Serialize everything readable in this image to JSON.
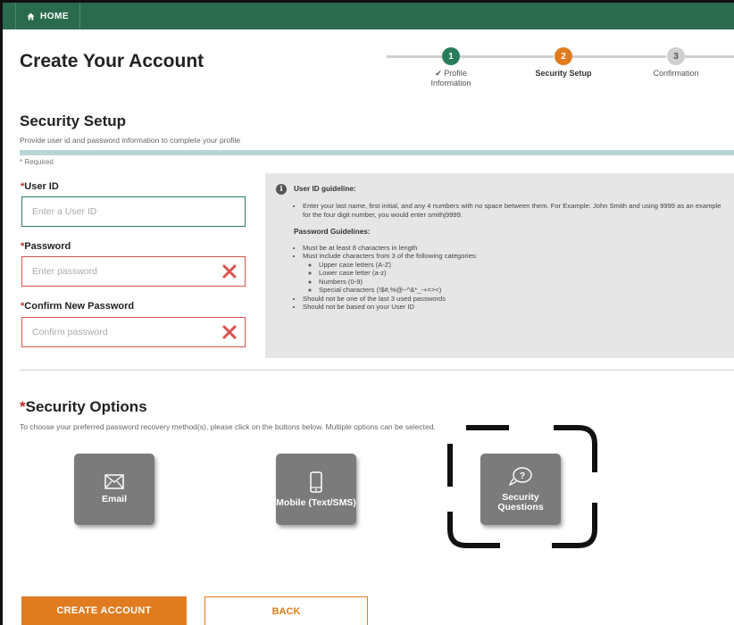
{
  "nav": {
    "home_label": "HOME"
  },
  "page": {
    "title": "Create Your Account"
  },
  "stepper": {
    "steps": [
      {
        "number": "1",
        "label": "✔ Profile Information",
        "color": "#2a7d5c",
        "state": "done"
      },
      {
        "number": "2",
        "label": "Security Setup",
        "color": "#e07c1f",
        "state": "current"
      },
      {
        "number": "3",
        "label": "Confirmation",
        "color": "#cfcfcf",
        "state": "upcoming"
      }
    ]
  },
  "security_setup": {
    "title": "Security Setup",
    "description": "Provide user id and password information to complete your profile",
    "required_note": "* Required",
    "fields": {
      "user_id": {
        "label": "User ID",
        "placeholder": "Enter a User ID",
        "value": ""
      },
      "password": {
        "label": "Password",
        "placeholder": "Enter password",
        "value": ""
      },
      "confirm": {
        "label": "Confirm New Password",
        "placeholder": "Confirm password",
        "value": ""
      }
    }
  },
  "guidelines": {
    "user_id_heading": "User ID guideline:",
    "user_id_items": [
      "Enter your last name, first initial, and any 4 numbers with no space between them. For Example: John Smith and using 9999 as an example for the four digit number, you would enter smithj9999."
    ],
    "password_heading": "Password Guidelines:",
    "password_items_a": [
      "Must be at least 8 characters in length",
      "Must include characters from 3 of the following categories:"
    ],
    "password_categories": [
      "Upper case letters (A-Z)",
      "Lower case letter (a-z)",
      "Numbers (0-9)",
      "Special characters (!$#,%@~^&*_-+=><)"
    ],
    "password_items_b": [
      "Should not be one of the last 3 used passwords",
      "Should not be based on your User ID"
    ]
  },
  "security_options": {
    "title": "Security Options",
    "description": "To choose your preferred password recovery method(s), please click on the buttons below. Multiple options can be selected.",
    "options": [
      {
        "label": "Email",
        "icon": "envelope-icon"
      },
      {
        "label": "Mobile (Text/SMS)",
        "icon": "mobile-phone-icon"
      },
      {
        "label": "Security Questions",
        "icon": "question-chat-icon"
      }
    ]
  },
  "actions": {
    "create_label": "CREATE ACCOUNT",
    "back_label": "BACK"
  },
  "colors": {
    "brand_green": "#2a6b4e",
    "accent_orange": "#e07c1f",
    "error_red": "#d9534f",
    "option_gray": "#7b7b7b"
  }
}
